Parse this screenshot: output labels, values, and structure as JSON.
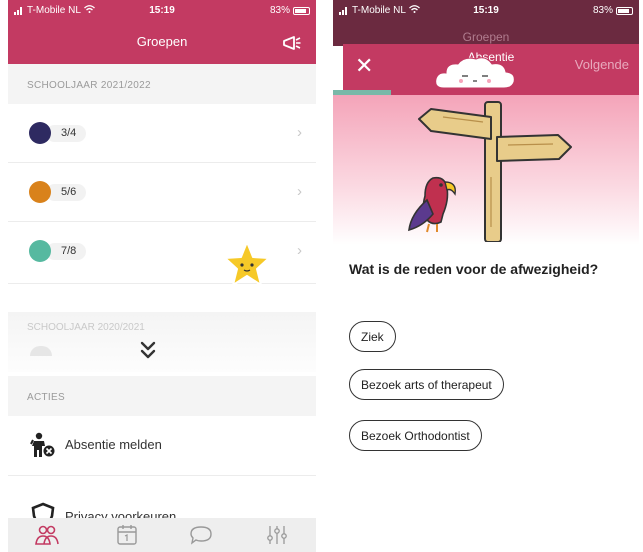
{
  "left_screen": {
    "status": {
      "carrier": "T-Mobile NL",
      "time": "15:19",
      "battery": "83%"
    },
    "header": {
      "title": "Groepen",
      "megaphone_icon": "megaphone-icon"
    },
    "section_current": "SCHOOLJAAR 2021/2022",
    "groups": [
      {
        "label": "3/4",
        "color": "#2e2a61"
      },
      {
        "label": "5/6",
        "color": "#d9821b"
      },
      {
        "label": "7/8",
        "color": "#56b9a0"
      }
    ],
    "section_previous": "SCHOOLJAAR 2020/2021",
    "section_actions": "ACTIES",
    "actions": [
      {
        "label": "Absentie melden",
        "icon": "absence-person-icon"
      },
      {
        "label": "Privacy voorkeuren",
        "icon": "shield-icon"
      }
    ],
    "tabbar": [
      "groups-icon",
      "calendar-icon",
      "chat-icon",
      "settings-sliders-icon"
    ]
  },
  "right_screen": {
    "status": {
      "carrier": "T-Mobile NL",
      "time": "15:19",
      "battery": "83%"
    },
    "behind_title": "Groepen",
    "modal": {
      "close": "✕",
      "title": "Absentie",
      "next": "Volgende",
      "progress": 0.19
    },
    "question": "Wat is de reden voor de afwezigheid?",
    "options": [
      "Ziek",
      "Bezoek arts of therapeut",
      "Bezoek Orthodontist"
    ]
  },
  "colors": {
    "brand": "#c33a62",
    "progress": "#79b8a8"
  }
}
